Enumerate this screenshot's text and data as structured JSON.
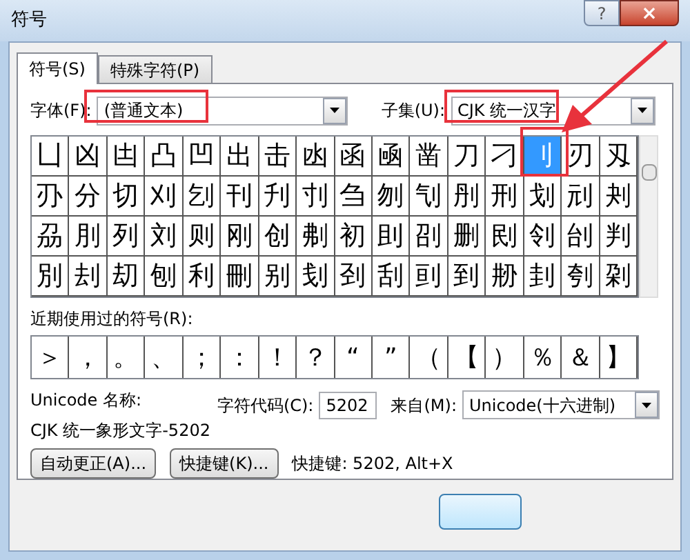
{
  "window": {
    "title": "符号",
    "help": "?",
    "close": "×"
  },
  "tabs": [
    {
      "label": "符号(S)",
      "selected": true
    },
    {
      "label": "特殊字符(P)",
      "selected": false
    }
  ],
  "font": {
    "label": "字体(F):",
    "value": "(普通文本)"
  },
  "subset": {
    "label": "子集(U):",
    "value": "CJK 统一汉字"
  },
  "grid": {
    "rows": [
      [
        {
          "char": "凵",
          "selected": false
        },
        {
          "char": "凶",
          "selected": false
        },
        {
          "char": "凷",
          "selected": false
        },
        {
          "char": "凸",
          "selected": false
        },
        {
          "char": "凹",
          "selected": false
        },
        {
          "char": "出",
          "selected": false
        },
        {
          "char": "击",
          "selected": false
        },
        {
          "char": "凼",
          "selected": false
        },
        {
          "char": "函",
          "selected": false
        },
        {
          "char": "凾",
          "selected": false
        },
        {
          "char": "凿",
          "selected": false
        },
        {
          "char": "刀",
          "selected": false
        },
        {
          "char": "刁",
          "selected": false
        },
        {
          "char": "刂",
          "selected": true
        },
        {
          "char": "刃",
          "selected": false
        },
        {
          "char": "刄",
          "selected": false
        }
      ],
      [
        {
          "char": "刅",
          "selected": false
        },
        {
          "char": "分",
          "selected": false
        },
        {
          "char": "切",
          "selected": false
        },
        {
          "char": "刈",
          "selected": false
        },
        {
          "char": "刉",
          "selected": false
        },
        {
          "char": "刊",
          "selected": false
        },
        {
          "char": "刋",
          "selected": false
        },
        {
          "char": "刌",
          "selected": false
        },
        {
          "char": "刍",
          "selected": false
        },
        {
          "char": "刎",
          "selected": false
        },
        {
          "char": "刏",
          "selected": false
        },
        {
          "char": "刐",
          "selected": false
        },
        {
          "char": "刑",
          "selected": false
        },
        {
          "char": "划",
          "selected": false
        },
        {
          "char": "刓",
          "selected": false
        },
        {
          "char": "刔",
          "selected": false
        }
      ],
      [
        {
          "char": "刕",
          "selected": false
        },
        {
          "char": "刖",
          "selected": false
        },
        {
          "char": "列",
          "selected": false
        },
        {
          "char": "刘",
          "selected": false
        },
        {
          "char": "则",
          "selected": false
        },
        {
          "char": "刚",
          "selected": false
        },
        {
          "char": "创",
          "selected": false
        },
        {
          "char": "刜",
          "selected": false
        },
        {
          "char": "初",
          "selected": false
        },
        {
          "char": "刞",
          "selected": false
        },
        {
          "char": "刟",
          "selected": false
        },
        {
          "char": "删",
          "selected": false
        },
        {
          "char": "刡",
          "selected": false
        },
        {
          "char": "刢",
          "selected": false
        },
        {
          "char": "刣",
          "selected": false
        },
        {
          "char": "判",
          "selected": false
        }
      ],
      [
        {
          "char": "別",
          "selected": false
        },
        {
          "char": "刦",
          "selected": false
        },
        {
          "char": "刧",
          "selected": false
        },
        {
          "char": "刨",
          "selected": false
        },
        {
          "char": "利",
          "selected": false
        },
        {
          "char": "刪",
          "selected": false
        },
        {
          "char": "别",
          "selected": false
        },
        {
          "char": "刬",
          "selected": false
        },
        {
          "char": "刭",
          "selected": false
        },
        {
          "char": "刮",
          "selected": false
        },
        {
          "char": "刯",
          "selected": false
        },
        {
          "char": "到",
          "selected": false
        },
        {
          "char": "刱",
          "selected": false
        },
        {
          "char": "刲",
          "selected": false
        },
        {
          "char": "刳",
          "selected": false
        },
        {
          "char": "刴",
          "selected": false
        }
      ]
    ]
  },
  "recent": {
    "label": "近期使用过的符号(R):",
    "symbols": [
      "＞",
      "，",
      "。",
      "、",
      "；",
      "：",
      "！",
      "？",
      "“",
      "”",
      "（",
      "【",
      "）",
      "％",
      "＆",
      "】"
    ]
  },
  "unicode_name": {
    "label": "Unicode 名称:",
    "value": "CJK 统一象形文字-5202"
  },
  "char_code": {
    "label": "字符代码(C):",
    "value": "5202"
  },
  "from": {
    "label": "来自(M):",
    "value": "Unicode(十六进制)"
  },
  "buttons": [
    "自动更正(A)...",
    "快捷键(K)..."
  ],
  "shortcut": "快捷键: 5202, Alt+X"
}
